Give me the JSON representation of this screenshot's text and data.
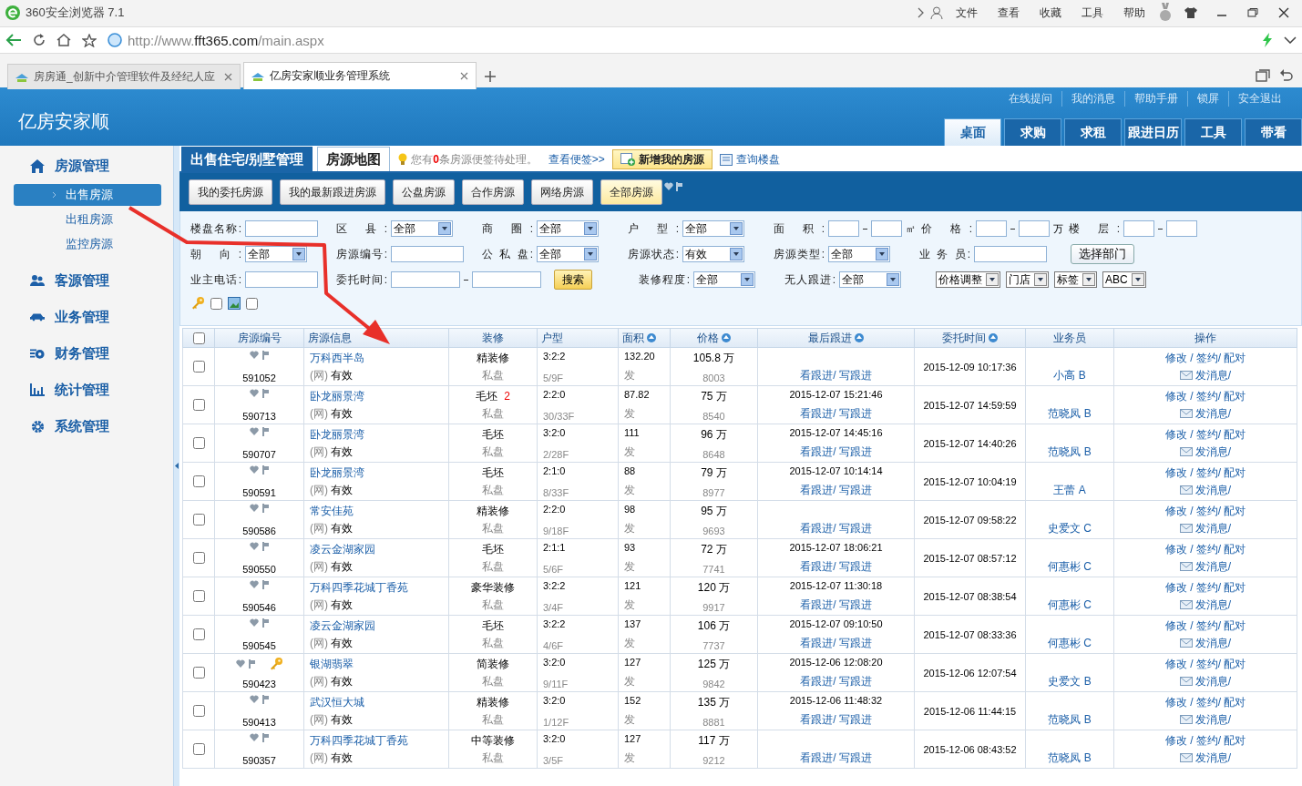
{
  "browser": {
    "title": "360安全浏览器 7.1",
    "menu": [
      "文件",
      "查看",
      "收藏",
      "工具",
      "帮助"
    ],
    "url": {
      "prefix": "http://www.",
      "domain": "fft365.com",
      "path": "/main.aspx"
    },
    "tabs": [
      {
        "label": "房房通_创新中介管理软件及经纪人应",
        "selected": false
      },
      {
        "label": "亿房安家顺业务管理系统",
        "selected": true
      }
    ]
  },
  "app": {
    "logo": "亿房安家顺",
    "top_links": [
      "在线提问",
      "我的消息",
      "帮助手册",
      "锁屏",
      "安全退出"
    ],
    "nav": [
      {
        "label": "桌面",
        "selected": true
      },
      {
        "label": "求购",
        "selected": false
      },
      {
        "label": "求租",
        "selected": false
      },
      {
        "label": "跟进日历",
        "selected": false
      },
      {
        "label": "工具",
        "selected": false
      },
      {
        "label": "带看",
        "selected": false
      }
    ]
  },
  "sidebar": [
    {
      "label": "房源管理",
      "children": [
        {
          "label": "出售房源",
          "selected": true
        },
        {
          "label": "出租房源",
          "selected": false
        },
        {
          "label": "监控房源",
          "selected": false
        }
      ]
    },
    {
      "label": "客源管理"
    },
    {
      "label": "业务管理"
    },
    {
      "label": "财务管理"
    },
    {
      "label": "统计管理"
    },
    {
      "label": "系统管理"
    }
  ],
  "content_tabs": [
    {
      "label": "出售住宅/别墅管理",
      "selected": true
    },
    {
      "label": "房源地图",
      "selected": false
    }
  ],
  "notice": {
    "before": "您有",
    "count": "0",
    "after": "条房源便签待处理。",
    "link": "查看便签>>"
  },
  "add_button": "新增我的房源",
  "query_link": "查询楼盘",
  "toolbar": [
    {
      "label": "我的委托房源",
      "selected": false
    },
    {
      "label": "我的最新跟进房源",
      "selected": false
    },
    {
      "label": "公盘房源",
      "selected": false
    },
    {
      "label": "合作房源",
      "selected": false
    },
    {
      "label": "网络房源",
      "selected": false
    },
    {
      "label": "全部房源",
      "selected": true
    }
  ],
  "filters": {
    "rows": [
      [
        {
          "kind": "text",
          "label": "楼盘名称:"
        },
        {
          "kind": "select",
          "label": "区 县:",
          "value": "全部"
        },
        {
          "kind": "select",
          "label": "商 圈:",
          "value": "全部"
        },
        {
          "kind": "select",
          "label": "户 型:",
          "value": "全部"
        },
        {
          "kind": "range",
          "label": "面 积:",
          "unit": "㎡"
        },
        {
          "kind": "range",
          "label": "价 格:",
          "unit": "万"
        },
        {
          "kind": "range",
          "label": "楼 层:"
        }
      ],
      [
        {
          "kind": "select",
          "label": "朝 向:",
          "value": "全部"
        },
        {
          "kind": "text",
          "label": "房源编号:"
        },
        {
          "kind": "select",
          "label": "公 私 盘:",
          "value": "全部"
        },
        {
          "kind": "select",
          "label": "房源状态:",
          "value": "有效"
        },
        {
          "kind": "select",
          "label": "房源类型:",
          "value": "全部"
        },
        {
          "kind": "text",
          "label": "业 务 员:"
        },
        {
          "kind": "button",
          "label": "选择部门"
        }
      ],
      [
        {
          "kind": "text",
          "label": "业主电话:"
        },
        {
          "kind": "date_range",
          "label": "委托时间:"
        },
        {
          "kind": "search",
          "label": "搜索"
        },
        {
          "kind": "select",
          "label": "装修程度:",
          "value": "全部"
        },
        {
          "kind": "select",
          "label": "无人跟进:",
          "value": "全部"
        }
      ]
    ],
    "mini_selects": [
      "价格调整",
      "门店",
      "标签",
      "ABC"
    ],
    "flags": [
      {
        "checked": false
      },
      {
        "checked": false
      }
    ]
  },
  "table": {
    "select_all": {
      "checked": false
    },
    "columns": [
      {
        "label": "房源编号",
        "sortable": false
      },
      {
        "label": "房源信息",
        "sortable": false
      },
      {
        "label": "装修",
        "sortable": false
      },
      {
        "label": "户型",
        "sortable": false
      },
      {
        "label": "面积",
        "sortable": true
      },
      {
        "label": "价格",
        "sortable": true
      },
      {
        "label": "最后跟进",
        "sortable": true
      },
      {
        "label": "委托时间",
        "sortable": true
      },
      {
        "label": "业务员",
        "sortable": false
      },
      {
        "label": "操作",
        "sortable": false
      }
    ],
    "rows": [
      {
        "checked": false,
        "has_key": false,
        "id": "591052",
        "name": "万科西半岛",
        "source": "(网)",
        "status": "有效",
        "decoration": "精装修",
        "ownership": "私盘",
        "layout": "3:2:2",
        "floor": "5/9F",
        "area": "132.20",
        "area_note": "发",
        "price": "105.8 万",
        "unit_price": "8003",
        "view_follow": "看跟进/",
        "write_follow": "写跟进",
        "commission_time": "2015-12-09 10:17:36",
        "agent": "小高 B",
        "edit": "修改 /",
        "sign": "签约/",
        "match": "配对",
        "message": "发消息/"
      },
      {
        "checked": false,
        "has_key": false,
        "id": "590713",
        "name": "卧龙丽景湾",
        "source": "(网)",
        "status": "有效",
        "decoration": "毛坯",
        "decoration_count": "2",
        "ownership": "私盘",
        "layout": "2:2:0",
        "floor": "30/33F",
        "area": "87.82",
        "area_note": "发",
        "price": "75 万",
        "unit_price": "8540",
        "last_follow": "2015-12-07 15:21:46",
        "view_follow": "看跟进/",
        "write_follow": "写跟进",
        "commission_time": "2015-12-07 14:59:59",
        "agent": "范晓凤 B",
        "edit": "修改 /",
        "sign": "签约/",
        "match": "配对",
        "message": "发消息/"
      },
      {
        "checked": false,
        "has_key": false,
        "id": "590707",
        "name": "卧龙丽景湾",
        "source": "(网)",
        "status": "有效",
        "decoration": "毛坯",
        "ownership": "私盘",
        "layout": "3:2:0",
        "floor": "2/28F",
        "area": "111",
        "area_note": "发",
        "price": "96 万",
        "unit_price": "8648",
        "last_follow": "2015-12-07 14:45:16",
        "view_follow": "看跟进/",
        "write_follow": "写跟进",
        "commission_time": "2015-12-07 14:40:26",
        "agent": "范晓凤 B",
        "edit": "修改 /",
        "sign": "签约/",
        "match": "配对",
        "message": "发消息/"
      },
      {
        "checked": false,
        "has_key": false,
        "id": "590591",
        "name": "卧龙丽景湾",
        "source": "(网)",
        "status": "有效",
        "decoration": "毛坯",
        "ownership": "私盘",
        "layout": "2:1:0",
        "floor": "8/33F",
        "area": "88",
        "area_note": "发",
        "price": "79 万",
        "unit_price": "8977",
        "last_follow": "2015-12-07 10:14:14",
        "view_follow": "看跟进/",
        "write_follow": "写跟进",
        "commission_time": "2015-12-07 10:04:19",
        "agent": "王蕾 A",
        "edit": "修改 /",
        "sign": "签约/",
        "match": "配对",
        "message": "发消息/"
      },
      {
        "checked": false,
        "has_key": false,
        "id": "590586",
        "name": "常安佳苑",
        "source": "(网)",
        "status": "有效",
        "decoration": "精装修",
        "ownership": "私盘",
        "layout": "2:2:0",
        "floor": "9/18F",
        "area": "98",
        "area_note": "发",
        "price": "95 万",
        "unit_price": "9693",
        "view_follow": "看跟进/",
        "write_follow": "写跟进",
        "commission_time": "2015-12-07 09:58:22",
        "agent": "史爱文 C",
        "edit": "修改 /",
        "sign": "签约/",
        "match": "配对",
        "message": "发消息/"
      },
      {
        "checked": false,
        "has_key": false,
        "id": "590550",
        "name": "凌云金湖家园",
        "source": "(网)",
        "status": "有效",
        "decoration": "毛坯",
        "ownership": "私盘",
        "layout": "2:1:1",
        "floor": "5/6F",
        "area": "93",
        "area_note": "发",
        "price": "72 万",
        "unit_price": "7741",
        "last_follow": "2015-12-07 18:06:21",
        "view_follow": "看跟进/",
        "write_follow": "写跟进",
        "commission_time": "2015-12-07 08:57:12",
        "agent": "何惠彬 C",
        "edit": "修改 /",
        "sign": "签约/",
        "match": "配对",
        "message": "发消息/"
      },
      {
        "checked": false,
        "has_key": false,
        "id": "590546",
        "name": "万科四季花城丁香苑",
        "source": "(网)",
        "status": "有效",
        "decoration": "豪华装修",
        "ownership": "私盘",
        "layout": "3:2:2",
        "floor": "3/4F",
        "area": "121",
        "area_note": "发",
        "price": "120 万",
        "unit_price": "9917",
        "last_follow": "2015-12-07 11:30:18",
        "view_follow": "看跟进/",
        "write_follow": "写跟进",
        "commission_time": "2015-12-07 08:38:54",
        "agent": "何惠彬 C",
        "edit": "修改 /",
        "sign": "签约/",
        "match": "配对",
        "message": "发消息/"
      },
      {
        "checked": false,
        "has_key": false,
        "id": "590545",
        "name": "凌云金湖家园",
        "source": "(网)",
        "status": "有效",
        "decoration": "毛坯",
        "ownership": "私盘",
        "layout": "3:2:2",
        "floor": "4/6F",
        "area": "137",
        "area_note": "发",
        "price": "106 万",
        "unit_price": "7737",
        "last_follow": "2015-12-07 09:10:50",
        "view_follow": "看跟进/",
        "write_follow": "写跟进",
        "commission_time": "2015-12-07 08:33:36",
        "agent": "何惠彬 C",
        "edit": "修改 /",
        "sign": "签约/",
        "match": "配对",
        "message": "发消息/"
      },
      {
        "checked": false,
        "has_key": true,
        "id": "590423",
        "name": "银湖翡翠",
        "source": "(网)",
        "status": "有效",
        "decoration": "简装修",
        "ownership": "私盘",
        "layout": "3:2:0",
        "floor": "9/11F",
        "area": "127",
        "area_note": "发",
        "price": "125 万",
        "unit_price": "9842",
        "last_follow": "2015-12-06 12:08:20",
        "view_follow": "看跟进/",
        "write_follow": "写跟进",
        "commission_time": "2015-12-06 12:07:54",
        "agent": "史爱文 B",
        "edit": "修改 /",
        "sign": "签约/",
        "match": "配对",
        "message": "发消息/"
      },
      {
        "checked": false,
        "has_key": false,
        "id": "590413",
        "name": "武汉恒大城",
        "source": "(网)",
        "status": "有效",
        "decoration": "精装修",
        "ownership": "私盘",
        "layout": "3:2:0",
        "floor": "1/12F",
        "area": "152",
        "area_note": "发",
        "price": "135 万",
        "unit_price": "8881",
        "last_follow": "2015-12-06 11:48:32",
        "view_follow": "看跟进/",
        "write_follow": "写跟进",
        "commission_time": "2015-12-06 11:44:15",
        "agent": "范晓凤 B",
        "edit": "修改 /",
        "sign": "签约/",
        "match": "配对",
        "message": "发消息/"
      },
      {
        "checked": false,
        "has_key": false,
        "id": "590357",
        "name": "万科四季花城丁香苑",
        "source": "(网)",
        "status": "有效",
        "decoration": "中等装修",
        "ownership": "私盘",
        "layout": "3:2:0",
        "floor": "3/5F",
        "area": "127",
        "area_note": "发",
        "price": "117 万",
        "unit_price": "9212",
        "view_follow": "看跟进/",
        "write_follow": "写跟进",
        "commission_time": "2015-12-06 08:43:52",
        "agent": "范晓凤 B",
        "edit": "修改 /",
        "sign": "签约/",
        "match": "配对",
        "message": "发消息/"
      }
    ]
  }
}
